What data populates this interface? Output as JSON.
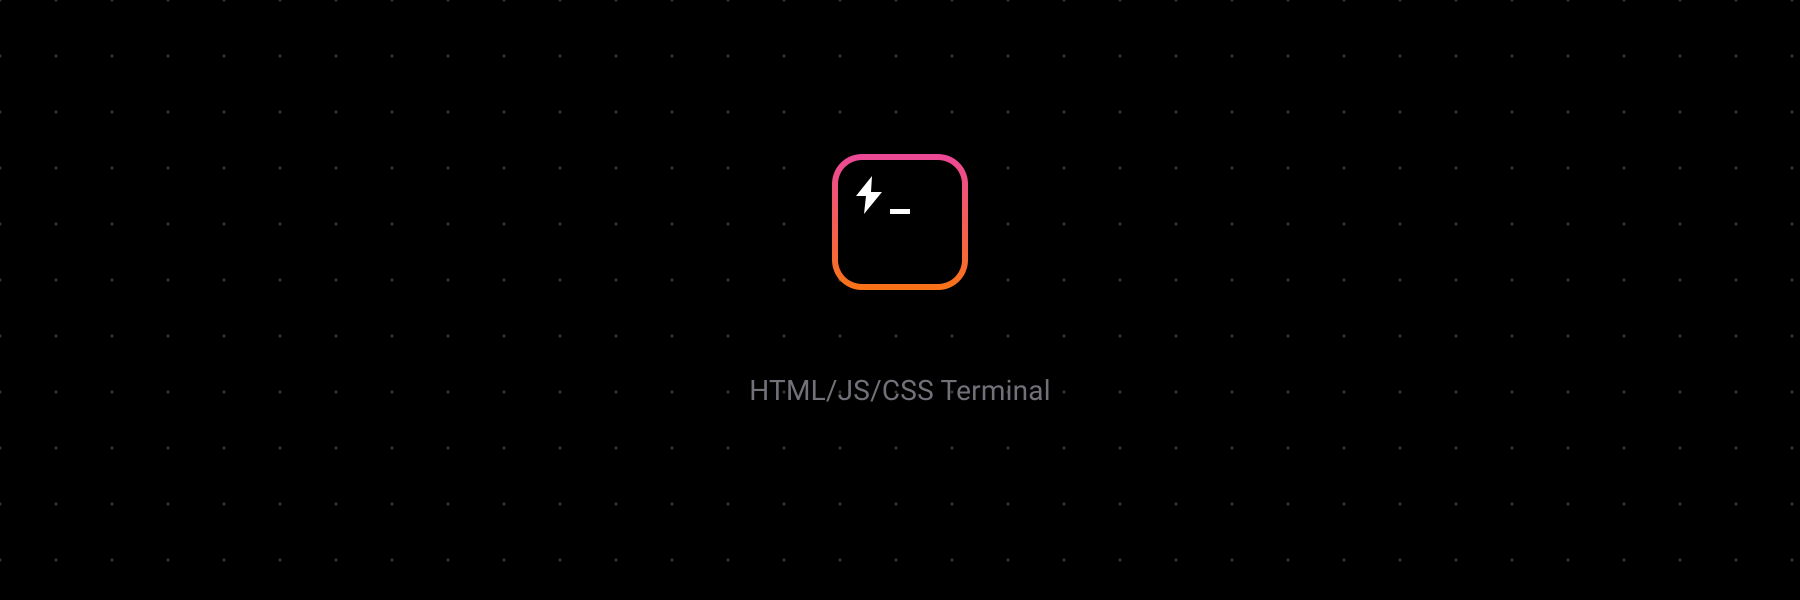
{
  "hero": {
    "title": "HTML/JS/CSS Terminal",
    "icon_name": "terminal-lightning-icon"
  }
}
